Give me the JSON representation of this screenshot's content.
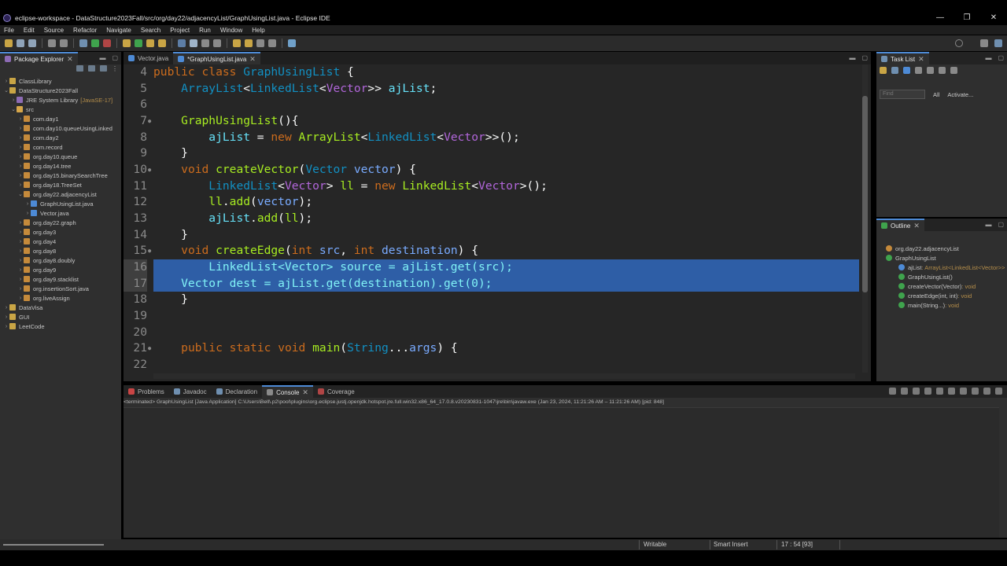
{
  "window": {
    "title": "eclipse-workspace - DataStructure2023Fall/src/org/day22/adjacencyList/GraphUsingList.java - Eclipse IDE",
    "minimize": "—",
    "maximize": "❐",
    "close": "✕"
  },
  "menu": [
    "File",
    "Edit",
    "Source",
    "Refactor",
    "Navigate",
    "Search",
    "Project",
    "Run",
    "Window",
    "Help"
  ],
  "package_explorer": {
    "title": "Package Explorer",
    "items": [
      {
        "label": "ClassLibrary",
        "indent": 0,
        "arrow": "›",
        "icon": "project"
      },
      {
        "label": "DataStructure2023Fall",
        "indent": 0,
        "arrow": "⌄",
        "icon": "project"
      },
      {
        "label": "JRE System Library",
        "suffix": "[JavaSE-17]",
        "indent": 1,
        "arrow": "›",
        "icon": "library"
      },
      {
        "label": "src",
        "indent": 1,
        "arrow": "⌄",
        "icon": "folder"
      },
      {
        "label": "com.day1",
        "indent": 2,
        "arrow": "›",
        "icon": "package"
      },
      {
        "label": "com.day10.queueUsingLinked",
        "indent": 2,
        "arrow": "›",
        "icon": "package"
      },
      {
        "label": "com.day2",
        "indent": 2,
        "arrow": "›",
        "icon": "package"
      },
      {
        "label": "com.record",
        "indent": 2,
        "arrow": "›",
        "icon": "package"
      },
      {
        "label": "org.day10.queue",
        "indent": 2,
        "arrow": "›",
        "icon": "package"
      },
      {
        "label": "org.day14.tree",
        "indent": 2,
        "arrow": "›",
        "icon": "package"
      },
      {
        "label": "org.day15.binarySearchTree",
        "indent": 2,
        "arrow": "›",
        "icon": "package"
      },
      {
        "label": "org.day18.TreeSet",
        "indent": 2,
        "arrow": "›",
        "icon": "package"
      },
      {
        "label": "org.day22.adjacencyList",
        "indent": 2,
        "arrow": "⌄",
        "icon": "package"
      },
      {
        "label": "GraphUsingList.java",
        "indent": 3,
        "arrow": "›",
        "icon": "java"
      },
      {
        "label": "Vector.java",
        "indent": 3,
        "arrow": "›",
        "icon": "java"
      },
      {
        "label": "org.day22.graph",
        "indent": 2,
        "arrow": "›",
        "icon": "package"
      },
      {
        "label": "org.day3",
        "indent": 2,
        "arrow": "›",
        "icon": "package"
      },
      {
        "label": "org.day4",
        "indent": 2,
        "arrow": "›",
        "icon": "package"
      },
      {
        "label": "org.day8",
        "indent": 2,
        "arrow": "›",
        "icon": "package"
      },
      {
        "label": "org.day8.doubly",
        "indent": 2,
        "arrow": "›",
        "icon": "package"
      },
      {
        "label": "org.day9",
        "indent": 2,
        "arrow": "›",
        "icon": "package"
      },
      {
        "label": "org.day9.stacklist",
        "indent": 2,
        "arrow": "›",
        "icon": "package"
      },
      {
        "label": "org.insertionSort.java",
        "indent": 2,
        "arrow": "›",
        "icon": "package"
      },
      {
        "label": "org.liveAssign",
        "indent": 2,
        "arrow": "›",
        "icon": "package"
      },
      {
        "label": "DataVisa",
        "indent": 0,
        "arrow": "›",
        "icon": "project"
      },
      {
        "label": "GUI",
        "indent": 0,
        "arrow": "›",
        "icon": "project"
      },
      {
        "label": "LeetCode",
        "indent": 0,
        "arrow": "›",
        "icon": "project"
      }
    ]
  },
  "editor": {
    "tabs": [
      {
        "label": "Vector.java",
        "active": false
      },
      {
        "label": "*GraphUsingList.java",
        "active": true
      }
    ],
    "lines": [
      {
        "n": "4",
        "marker": "",
        "selected": false,
        "tokens": [
          [
            "kw",
            "public "
          ],
          [
            "kw",
            "class "
          ],
          [
            "ty",
            "GraphUsingList"
          ],
          [
            "pl",
            " {"
          ]
        ]
      },
      {
        "n": "5",
        "marker": "",
        "selected": false,
        "tokens": [
          [
            "pl",
            "    "
          ],
          [
            "ty",
            "ArrayList"
          ],
          [
            "pl",
            "<"
          ],
          [
            "ty",
            "LinkedList"
          ],
          [
            "pl",
            "<"
          ],
          [
            "ge",
            "Vector"
          ],
          [
            "pl",
            ">> "
          ],
          [
            "vr",
            "ajList"
          ],
          [
            "pl",
            ";"
          ]
        ]
      },
      {
        "n": "6",
        "marker": "",
        "selected": false,
        "tokens": []
      },
      {
        "n": "7",
        "marker": "●",
        "selected": false,
        "tokens": [
          [
            "pl",
            "    "
          ],
          [
            "fn",
            "GraphUsingList"
          ],
          [
            "pl",
            "(){"
          ]
        ]
      },
      {
        "n": "8",
        "marker": "",
        "selected": false,
        "tokens": [
          [
            "pl",
            "        "
          ],
          [
            "vr",
            "ajList"
          ],
          [
            "pl",
            " = "
          ],
          [
            "kw",
            "new "
          ],
          [
            "fn",
            "ArrayList"
          ],
          [
            "pl",
            "<"
          ],
          [
            "ty",
            "LinkedList"
          ],
          [
            "pl",
            "<"
          ],
          [
            "ge",
            "Vector"
          ],
          [
            "pl",
            ">>();"
          ]
        ]
      },
      {
        "n": "9",
        "marker": "",
        "selected": false,
        "tokens": [
          [
            "pl",
            "    }"
          ]
        ]
      },
      {
        "n": "10",
        "marker": "●",
        "selected": false,
        "tokens": [
          [
            "pl",
            "    "
          ],
          [
            "kw",
            "void "
          ],
          [
            "fn",
            "createVector"
          ],
          [
            "pl",
            "("
          ],
          [
            "ty",
            "Vector "
          ],
          [
            "pa",
            "vector"
          ],
          [
            "pl",
            ") {"
          ]
        ]
      },
      {
        "n": "11",
        "marker": "",
        "selected": false,
        "tokens": [
          [
            "pl",
            "        "
          ],
          [
            "ty",
            "LinkedList"
          ],
          [
            "pl",
            "<"
          ],
          [
            "ge",
            "Vector"
          ],
          [
            "pl",
            "> "
          ],
          [
            "fn",
            "ll"
          ],
          [
            "pl",
            " = "
          ],
          [
            "kw",
            "new "
          ],
          [
            "fn",
            "LinkedList"
          ],
          [
            "pl",
            "<"
          ],
          [
            "ge",
            "Vector"
          ],
          [
            "pl",
            ">();"
          ]
        ]
      },
      {
        "n": "12",
        "marker": "",
        "selected": false,
        "tokens": [
          [
            "pl",
            "        "
          ],
          [
            "fn",
            "ll"
          ],
          [
            "pl",
            "."
          ],
          [
            "fn",
            "add"
          ],
          [
            "pl",
            "("
          ],
          [
            "pa",
            "vector"
          ],
          [
            "pl",
            ");"
          ]
        ]
      },
      {
        "n": "13",
        "marker": "",
        "selected": false,
        "tokens": [
          [
            "pl",
            "        "
          ],
          [
            "vr",
            "ajList"
          ],
          [
            "pl",
            "."
          ],
          [
            "fn",
            "add"
          ],
          [
            "pl",
            "("
          ],
          [
            "fn",
            "ll"
          ],
          [
            "pl",
            ");"
          ]
        ]
      },
      {
        "n": "14",
        "marker": "",
        "selected": false,
        "tokens": [
          [
            "pl",
            "    }"
          ]
        ]
      },
      {
        "n": "15",
        "marker": "●",
        "selected": false,
        "tokens": [
          [
            "pl",
            "    "
          ],
          [
            "kw",
            "void "
          ],
          [
            "fn",
            "createEdge"
          ],
          [
            "pl",
            "("
          ],
          [
            "kw",
            "int "
          ],
          [
            "pa",
            "src"
          ],
          [
            "pl",
            ", "
          ],
          [
            "kw",
            "int "
          ],
          [
            "pa",
            "destination"
          ],
          [
            "pl",
            ") {"
          ]
        ]
      },
      {
        "n": "16",
        "marker": "",
        "selected": true,
        "tokens": [
          [
            "pl",
            "        LinkedList<Vector> source = ajList.get(src);"
          ]
        ]
      },
      {
        "n": "17",
        "marker": "",
        "selected": true,
        "tokens": [
          [
            "pl",
            "    Vector dest = ajList.get(destination).get(0);"
          ]
        ]
      },
      {
        "n": "18",
        "marker": "",
        "selected": false,
        "tokens": [
          [
            "pl",
            "    }"
          ]
        ]
      },
      {
        "n": "19",
        "marker": "",
        "selected": false,
        "tokens": []
      },
      {
        "n": "20",
        "marker": "",
        "selected": false,
        "tokens": []
      },
      {
        "n": "21",
        "marker": "●",
        "selected": false,
        "tokens": [
          [
            "pl",
            "    "
          ],
          [
            "kw",
            "public "
          ],
          [
            "kw",
            "static "
          ],
          [
            "kw",
            "void "
          ],
          [
            "fn",
            "main"
          ],
          [
            "pl",
            "("
          ],
          [
            "ty",
            "String"
          ],
          [
            "pl",
            "..."
          ],
          [
            "pa",
            "args"
          ],
          [
            "pl",
            ") {"
          ]
        ]
      },
      {
        "n": "22",
        "marker": "",
        "selected": false,
        "tokens": []
      }
    ]
  },
  "task_list": {
    "title": "Task List",
    "find_placeholder": "Find",
    "all_label": "All",
    "activate_label": "Activate..."
  },
  "outline": {
    "title": "Outline",
    "items": [
      {
        "label": "org.day22.adjacencyList",
        "suffix": "",
        "indent": 0
      },
      {
        "label": "GraphUsingList",
        "suffix": "",
        "indent": 0
      },
      {
        "label": "ajList",
        "suffix": " : ArrayList<LinkedList<Vector>>",
        "indent": 1
      },
      {
        "label": "GraphUsingList()",
        "suffix": "",
        "indent": 1
      },
      {
        "label": "createVector(Vector)",
        "suffix": " : void",
        "indent": 1
      },
      {
        "label": "createEdge(int, int)",
        "suffix": " : void",
        "indent": 1
      },
      {
        "label": "main(String...)",
        "suffix": " : void",
        "indent": 1
      }
    ]
  },
  "bottom": {
    "tabs": [
      "Problems",
      "Javadoc",
      "Declaration",
      "Console",
      "Coverage"
    ],
    "active_tab": "Console",
    "terminated": "<terminated> GraphUsingList [Java Application] C:\\Users\\Bell\\.p2\\pool\\plugins\\org.eclipse.justj.openjdk.hotspot.jre.full.win32.x86_64_17.0.8.v20230831-1047\\jre\\bin\\javaw.exe (Jan 23, 2024, 11:21:26 AM – 11:21:26 AM) [pid: 848]"
  },
  "status": {
    "writable": "Writable",
    "insert_mode": "Smart Insert",
    "position": "17 : 54 [93]"
  },
  "colors": {
    "accent": "#4d8ad5",
    "selection": "#2e5ea6",
    "keyword": "#cc6c1d",
    "type": "#1290c3",
    "method": "#a7ec21",
    "field": "#66e1f8",
    "param": "#79abff",
    "generic": "#b166da"
  }
}
